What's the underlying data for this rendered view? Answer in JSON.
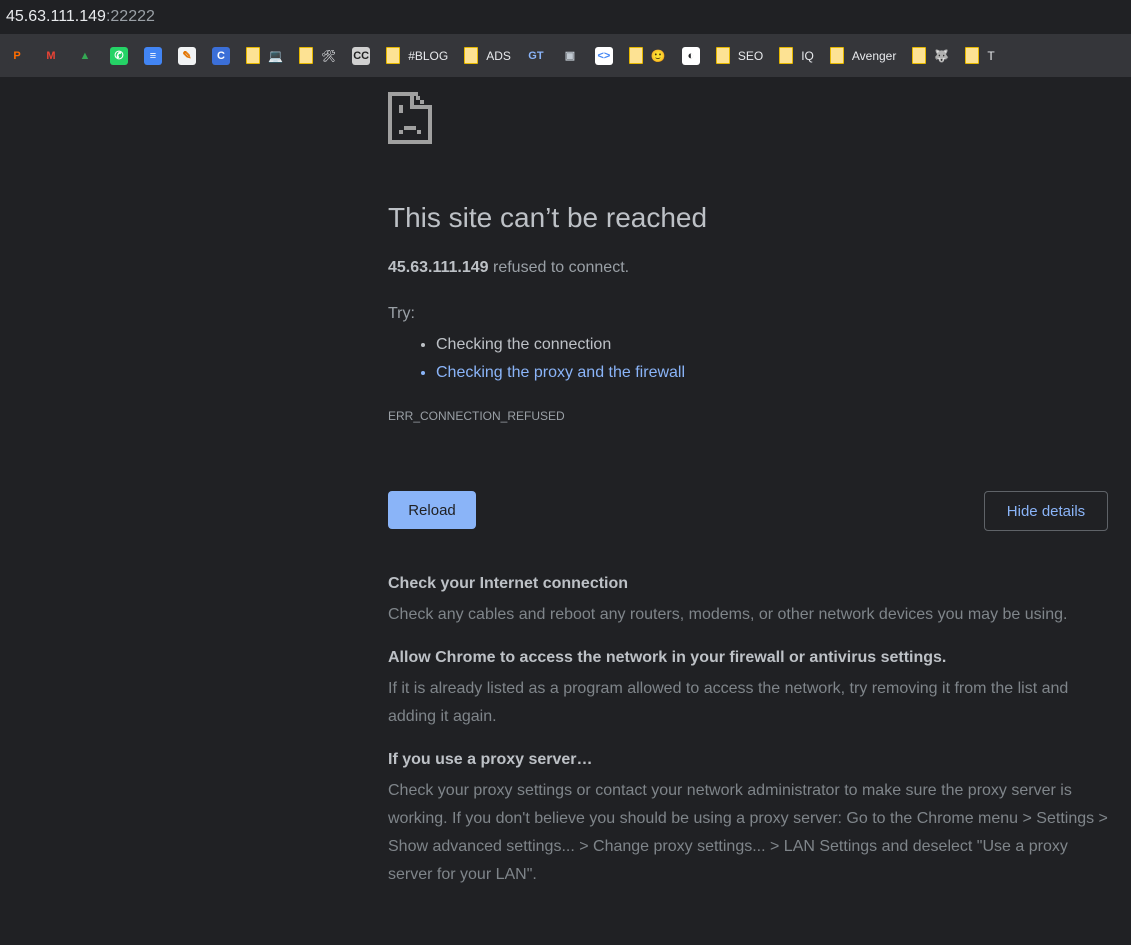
{
  "address_bar": {
    "host": "45.63.111.149",
    "port": ":22222"
  },
  "bookmarks": [
    {
      "icon": "partial-orange-icon",
      "label": ""
    },
    {
      "icon": "gmail-icon",
      "label": ""
    },
    {
      "icon": "google-drive-icon",
      "label": ""
    },
    {
      "icon": "whatsapp-icon",
      "label": ""
    },
    {
      "icon": "google-docs-icon",
      "label": ""
    },
    {
      "icon": "notepad-icon",
      "label": ""
    },
    {
      "icon": "canva-icon",
      "label": ""
    },
    {
      "icon": "folder-icon",
      "label": "💻"
    },
    {
      "icon": "folder-icon",
      "label": "🛠"
    },
    {
      "icon": "cc-icon",
      "label": ""
    },
    {
      "icon": "folder-icon",
      "label": "#BLOG"
    },
    {
      "icon": "folder-icon",
      "label": "ADS"
    },
    {
      "icon": "gt-icon",
      "label": ""
    },
    {
      "icon": "store-icon",
      "label": ""
    },
    {
      "icon": "code-icon",
      "label": ""
    },
    {
      "icon": "folder-icon",
      "label": "🙂"
    },
    {
      "icon": "globe-icon",
      "label": ""
    },
    {
      "icon": "folder-icon",
      "label": "SEO"
    },
    {
      "icon": "folder-icon",
      "label": "IQ"
    },
    {
      "icon": "folder-icon",
      "label": "Avenger"
    },
    {
      "icon": "folder-icon",
      "label": "🐺"
    },
    {
      "icon": "folder-icon",
      "label": "T"
    }
  ],
  "error": {
    "title": "This site can’t be reached",
    "host": "45.63.111.149",
    "message": " refused to connect.",
    "try_label": "Try:",
    "suggestions": [
      "Checking the connection",
      "Checking the proxy and the firewall"
    ],
    "code": "ERR_CONNECTION_REFUSED",
    "reload_label": "Reload",
    "hide_details_label": "Hide details"
  },
  "details": [
    {
      "heading": "Check your Internet connection",
      "text": "Check any cables and reboot any routers, modems, or other network devices you may be using."
    },
    {
      "heading": "Allow Chrome to access the network in your firewall or antivirus settings.",
      "text": "If it is already listed as a program allowed to access the network, try removing it from the list and adding it again."
    },
    {
      "heading": "If you use a proxy server…",
      "text": "Check your proxy settings or contact your network administrator to make sure the proxy server is working. If you don't believe you should be using a proxy server: Go to the Chrome menu > Settings > Show advanced settings... > Change proxy settings... > LAN Settings and deselect \"Use a proxy server for your LAN\"."
    }
  ],
  "colors": {
    "background": "#202124",
    "link": "#8ab4f8",
    "button": "#8ab4f8"
  }
}
